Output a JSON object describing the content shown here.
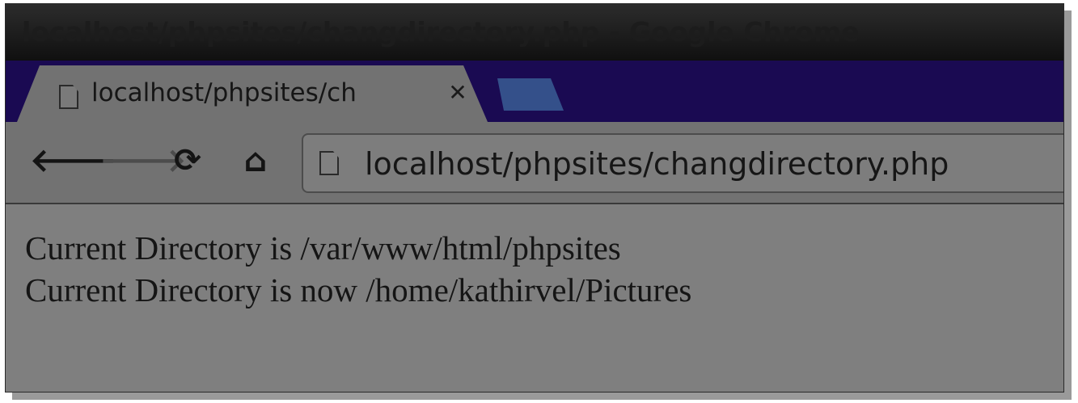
{
  "window": {
    "title": "localhost/phpsites/changdirectory.php - Google Chrome"
  },
  "tabs": [
    {
      "title": "localhost/phpsites/ch",
      "close_icon": "close-icon"
    }
  ],
  "toolbar": {
    "back_icon": "arrow-left-icon",
    "forward_icon": "arrow-right-icon",
    "reload_icon": "reload-icon",
    "home_icon": "home-icon",
    "url": "localhost/phpsites/changdirectory.php"
  },
  "page": {
    "lines": [
      "Current Directory is /var/www/html/phpsites",
      "Current Directory is now /home/kathirvel/Pictures"
    ]
  },
  "colors": {
    "tabstrip": "#1a0a52",
    "new_tab": "#34508a",
    "page_background": "#7f7f7f"
  }
}
